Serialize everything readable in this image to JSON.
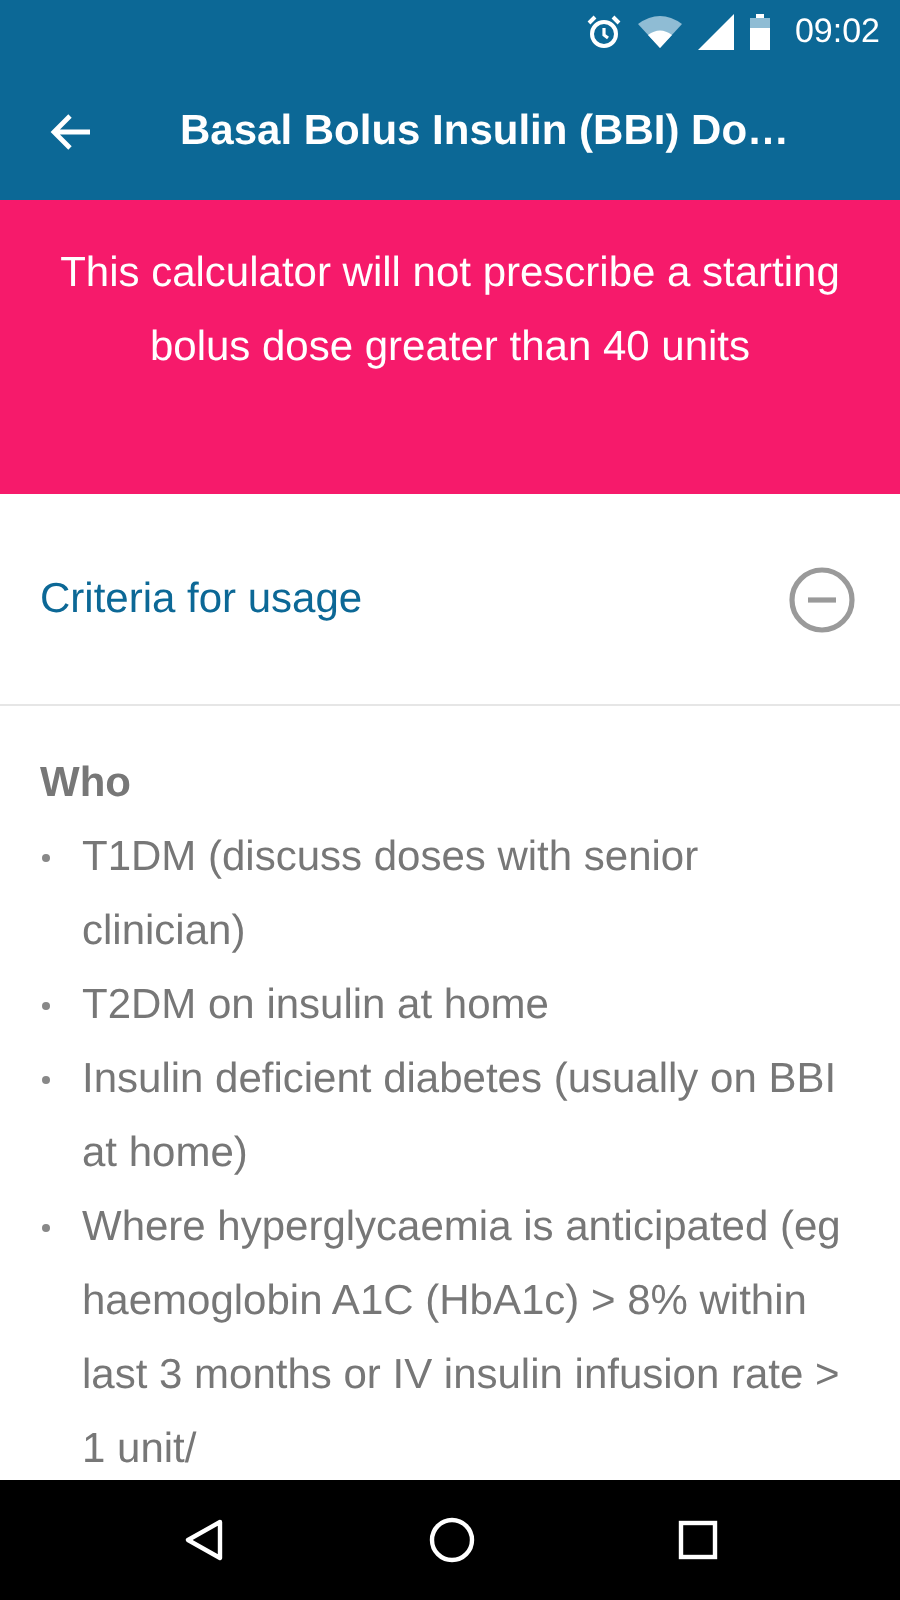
{
  "status_bar": {
    "time": "09:02"
  },
  "app_bar": {
    "title": "Basal Bolus Insulin (BBI) Do…"
  },
  "banner": {
    "text": "This calculator will not prescribe a starting bolus dose greater than 40 units"
  },
  "section": {
    "title": "Criteria for usage",
    "expanded": true
  },
  "content": {
    "heading": "Who",
    "items": [
      {
        "text": "T1DM (discuss doses with senior clinician)"
      },
      {
        "text": "T2DM on insulin at home"
      },
      {
        "text": "Insulin deficient diabetes (usually on BBI at home)"
      },
      {
        "text": "Where hyperglycaemia is anticipated (eg haemoglobin A1C (HbA1c) > 8% within last 3 months or IV insulin infusion rate > 1 unit/"
      }
    ]
  }
}
